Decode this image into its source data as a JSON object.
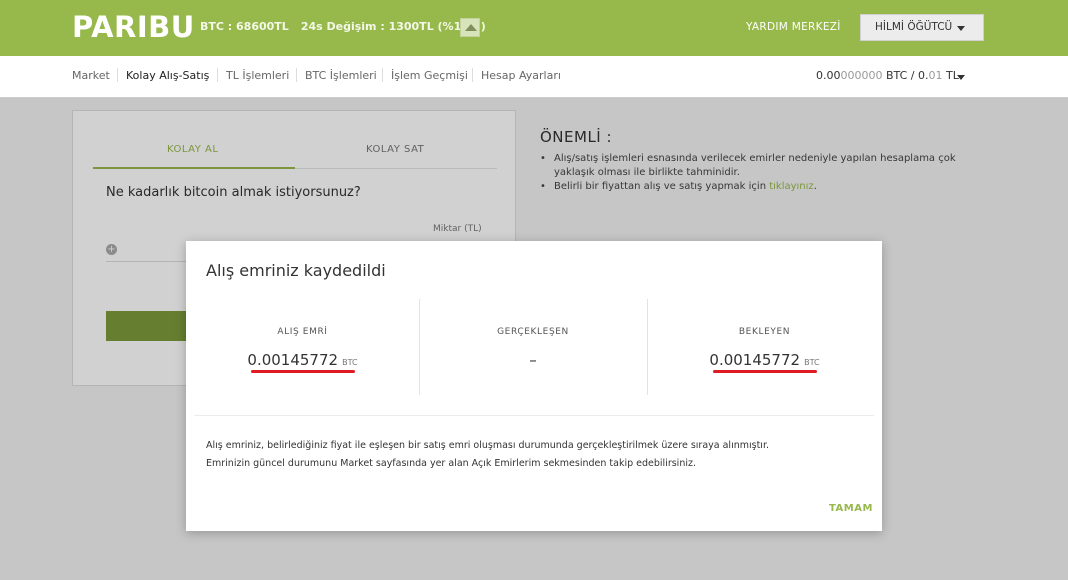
{
  "header": {
    "logo": "PARIBU",
    "ticker_price": "BTC : 68600TL",
    "ticker_change": "24s Değişim : 1300TL (%1.93)",
    "help_label": "YARDIM MERKEZİ",
    "user_name": "HİLMİ ÖĞÜTCÜ"
  },
  "nav": {
    "items": [
      {
        "label": "Market"
      },
      {
        "label": "Kolay Alış-Satış"
      },
      {
        "label": "TL İşlemleri"
      },
      {
        "label": "BTC İşlemleri"
      },
      {
        "label": "İşlem Geçmişi"
      },
      {
        "label": "Hesap Ayarları"
      }
    ],
    "balance_btc_main": "0.00",
    "balance_btc_dim": "000000",
    "balance_mid": " BTC / 0.",
    "balance_tl_dim": "01",
    "balance_tl_suffix": " TL"
  },
  "trade_card": {
    "tab_buy": "KOLAY AL",
    "tab_sell": "KOLAY SAT",
    "question": "Ne kadarlık bitcoin almak istiyorsunuz?",
    "amount_label": "Miktar (TL)",
    "plus": "+"
  },
  "info": {
    "title": "ÖNEMLİ :",
    "bullet1": "Alış/satış işlemleri esnasında verilecek emirler nedeniyle yapılan hesaplama çok yaklaşık olması ile birlikte tahminidir.",
    "bullet2_text": "Belirli bir fiyattan alış ve satış yapmak için ",
    "bullet2_link": "tıklayınız",
    "bullet2_end": "."
  },
  "modal": {
    "title": "Alış emriniz kaydedildi",
    "stats": [
      {
        "label": "ALIŞ EMRİ",
        "value": "0.00145772",
        "unit": "BTC"
      },
      {
        "label": "GERÇEKLEŞEN",
        "value": "–",
        "unit": ""
      },
      {
        "label": "BEKLEYEN",
        "value": "0.00145772",
        "unit": "BTC"
      }
    ],
    "line1": "Alış emriniz, belirlediğiniz fiyat ile eşleşen bir satış emri oluşması durumunda gerçekleştirilmek üzere sıraya alınmıştır.",
    "line2": "Emrinizin güncel durumunu Market sayfasında yer alan Açık Emirlerim sekmesinden takip edebilirsiniz.",
    "ok_label": "TAMAM"
  },
  "colors": {
    "brand_green": "#97b84a",
    "highlight_red": "#e01b24"
  }
}
